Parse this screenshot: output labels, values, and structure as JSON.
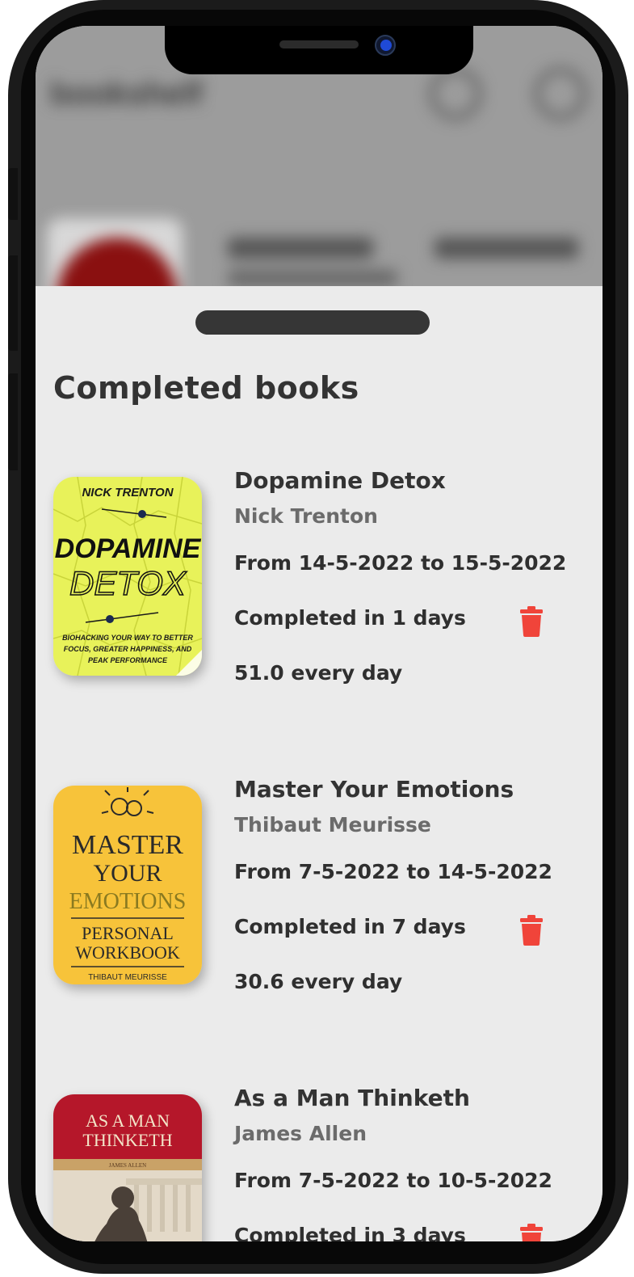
{
  "background_app": {
    "title": "bookshelf"
  },
  "sheet": {
    "title": "Completed books",
    "books": [
      {
        "title": "Dopamine Detox",
        "author": "Nick Trenton",
        "range": "From 14-5-2022 to 15-5-2022",
        "completed": "Completed in 1 days",
        "rate": "51.0 every day",
        "cover": {
          "author": "NICK TRENTON",
          "line1": "DOPAMINE",
          "line2": "DETOX",
          "subtitle1": "BIOHACKING YOUR WAY TO BETTER",
          "subtitle2": "FOCUS, GREATER HAPPINESS, AND",
          "subtitle3": "PEAK PERFORMANCE",
          "color": "#e8f25a"
        }
      },
      {
        "title": "Master Your Emotions",
        "author": "Thibaut Meurisse",
        "range": "From 7-5-2022 to 14-5-2022",
        "completed": "Completed in 7 days",
        "rate": "30.6 every day",
        "cover": {
          "line1": "MASTER",
          "line2": "YOUR",
          "line3": "EMOTIONS",
          "line4": "PERSONAL",
          "line5": "WORKBOOK",
          "author": "THIBAUT MEURISSE",
          "color": "#f7c33a"
        }
      },
      {
        "title": "As a Man Thinketh",
        "author": "James Allen",
        "range": "From 7-5-2022 to 10-5-2022",
        "completed": "Completed in 3 days",
        "cover": {
          "line1": "AS A MAN",
          "line2": "THINKETH",
          "author": "JAMES ALLEN",
          "color": "#b5172a"
        }
      }
    ]
  },
  "colors": {
    "accent_delete": "#f0443a",
    "sheet_background": "#ebebeb",
    "text_primary": "#333333",
    "text_secondary": "#6b6b6b"
  },
  "icons": {
    "delete": "trash-icon"
  }
}
